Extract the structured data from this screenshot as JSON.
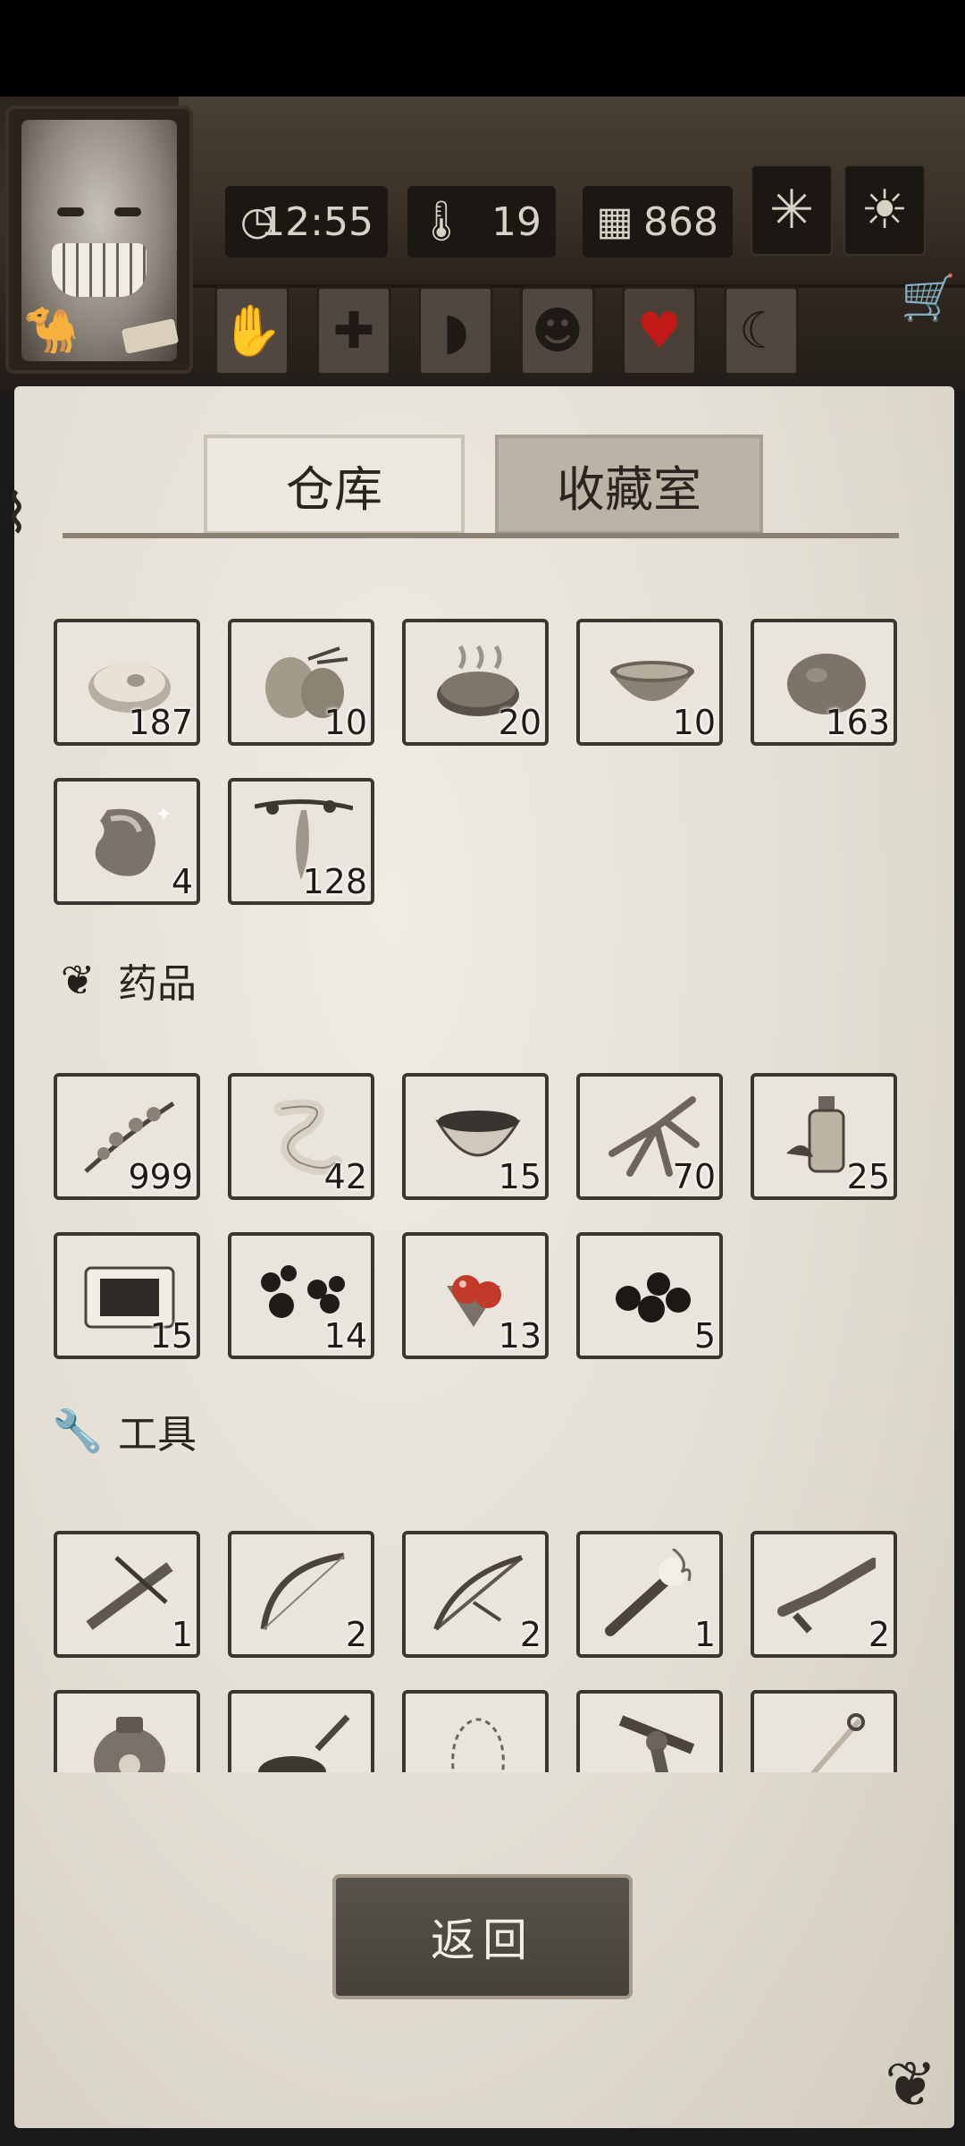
{
  "status": {
    "time": "12:55",
    "temperature": "19",
    "days": "868"
  },
  "top_icons": [
    "leaf-icon",
    "sun-icon"
  ],
  "conditions": [
    "hand-icon",
    "plus-icon",
    "stomach-icon",
    "head-icon",
    "heart-icon",
    "moon-icon"
  ],
  "tabs": {
    "warehouse": "仓库",
    "collection": "收藏室"
  },
  "food_items": [
    {
      "icon": "meat-icon",
      "qty": "187"
    },
    {
      "icon": "coconut-icon",
      "qty": "10"
    },
    {
      "icon": "grilled-meat-icon",
      "qty": "20"
    },
    {
      "icon": "soup-bowl-icon",
      "qty": "10"
    },
    {
      "icon": "potato-icon",
      "qty": "163"
    },
    {
      "icon": "bean-icon",
      "qty": "4"
    },
    {
      "icon": "hanging-fruit-icon",
      "qty": "128"
    }
  ],
  "medicine": {
    "title": "药品",
    "items": [
      {
        "icon": "herb-icon",
        "qty": "999"
      },
      {
        "icon": "bandage-icon",
        "qty": "42"
      },
      {
        "icon": "medicine-bowl-icon",
        "qty": "15"
      },
      {
        "icon": "ginseng-icon",
        "qty": "70"
      },
      {
        "icon": "potion-bottle-icon",
        "qty": "25"
      },
      {
        "icon": "plaster-icon",
        "qty": "15"
      },
      {
        "icon": "pills-icon",
        "qty": "14"
      },
      {
        "icon": "red-berries-icon",
        "qty": "13"
      },
      {
        "icon": "black-berries-icon",
        "qty": "5"
      }
    ]
  },
  "tools": {
    "title": "工具",
    "items": [
      {
        "icon": "crossbow-icon",
        "qty": "1"
      },
      {
        "icon": "bow-icon",
        "qty": "2"
      },
      {
        "icon": "compound-bow-icon",
        "qty": "2"
      },
      {
        "icon": "torch-icon",
        "qty": "1"
      },
      {
        "icon": "musket-icon",
        "qty": "2"
      },
      {
        "icon": "jar-icon",
        "qty": ""
      },
      {
        "icon": "frying-pan-icon",
        "qty": ""
      },
      {
        "icon": "empty-outline-icon",
        "qty": ""
      },
      {
        "icon": "revolver-icon",
        "qty": ""
      },
      {
        "icon": "sabre-icon",
        "qty": ""
      }
    ]
  },
  "back_button": "返回",
  "colors": {
    "heart": "#c21818",
    "paper": "#e3ded3",
    "button": "#4e4943"
  }
}
